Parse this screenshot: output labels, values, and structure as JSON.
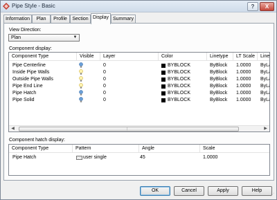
{
  "window": {
    "title": "Pipe Style - Basic",
    "help_label": "?",
    "close_label": "X"
  },
  "tabs": [
    {
      "label": "Information"
    },
    {
      "label": "Plan"
    },
    {
      "label": "Profile"
    },
    {
      "label": "Section"
    },
    {
      "label": "Display"
    },
    {
      "label": "Summary"
    }
  ],
  "active_tab": "Display",
  "view_direction": {
    "label": "View Direction:",
    "value": "Plan"
  },
  "component_display": {
    "label": "Component display:",
    "columns": [
      "Component Type",
      "Visible",
      "Layer",
      "Color",
      "Linetype",
      "LT Scale",
      "Line"
    ],
    "rows": [
      {
        "type": "Pipe Centerline",
        "visible": "on",
        "layer": "0",
        "color": "BYBLOCK",
        "linetype": "ByBlock",
        "lt_scale": "1.0000",
        "line": "ByLa"
      },
      {
        "type": "Inside Pipe Walls",
        "visible": "off",
        "layer": "0",
        "color": "BYBLOCK",
        "linetype": "ByBlock",
        "lt_scale": "1.0000",
        "line": "ByLa"
      },
      {
        "type": "Outside Pipe Walls",
        "visible": "off",
        "layer": "0",
        "color": "BYBLOCK",
        "linetype": "ByBlock",
        "lt_scale": "1.0000",
        "line": "ByLa"
      },
      {
        "type": "Pipe End Line",
        "visible": "off",
        "layer": "0",
        "color": "BYBLOCK",
        "linetype": "ByBlock",
        "lt_scale": "1.0000",
        "line": "ByLa"
      },
      {
        "type": "Pipe Hatch",
        "visible": "on",
        "layer": "0",
        "color": "BYBLOCK",
        "linetype": "ByBlock",
        "lt_scale": "1.0000",
        "line": "ByLa"
      },
      {
        "type": "Pipe Solid",
        "visible": "on",
        "layer": "0",
        "color": "BYBLOCK",
        "linetype": "ByBlock",
        "lt_scale": "1.0000",
        "line": "ByLa"
      }
    ]
  },
  "hatch_display": {
    "label": "Component hatch display:",
    "columns": [
      "Component Type",
      "Pattern",
      "Angle",
      "Scale"
    ],
    "rows": [
      {
        "type": "Pipe Hatch",
        "pattern": "user single",
        "angle": "45",
        "scale": "1.0000"
      }
    ]
  },
  "buttons": {
    "ok": "OK",
    "cancel": "Cancel",
    "apply": "Apply",
    "help": "Help"
  },
  "colors": {
    "bulb_on": "#6a9fd8",
    "bulb_off": "#e8d24a",
    "swatch": "#000000"
  },
  "icons": {
    "bulb": "lightbulb-icon",
    "swatch": "color-swatch-icon",
    "pattern": "hatch-pattern-icon"
  }
}
